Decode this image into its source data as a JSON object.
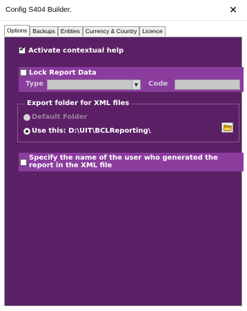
{
  "window": {
    "title": "Config S404 Builder.",
    "close_glyph": "✕"
  },
  "tabs": [
    {
      "label": "Options",
      "active": true
    },
    {
      "label": "Backups",
      "active": false
    },
    {
      "label": "Entities",
      "active": false
    },
    {
      "label": "Currency & Country",
      "active": false
    },
    {
      "label": "Licence",
      "active": false
    }
  ],
  "options": {
    "contextual_help": {
      "label": "Activate contextual help",
      "checked": true
    },
    "lock_report": {
      "label": "Lock Report Data",
      "checked": false,
      "type_label": "Type",
      "code_label": "Code",
      "type_value": "",
      "code_value": ""
    },
    "export_folder": {
      "legend": "Export folder for XML files",
      "default_label": "Default Folder",
      "use_this_label": "Use this: D:\\UIT\\BCLReporting\\",
      "selected": "use_this"
    },
    "specify_user": {
      "label": "Specify the name of the user who generated the report in the XML file",
      "checked": false
    }
  },
  "colors": {
    "panel": "#5b1f66",
    "band": "#8b3d9e",
    "disabled_text": "#9c80a3"
  },
  "icons": {
    "folder": "folder-open-icon",
    "close": "close-icon"
  }
}
